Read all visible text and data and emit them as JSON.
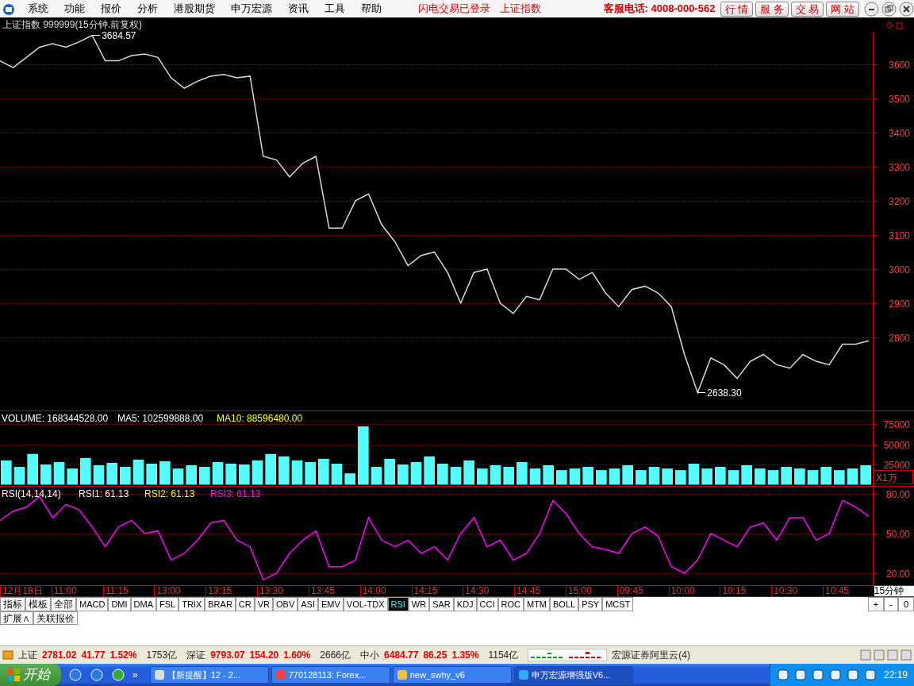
{
  "menu": {
    "items": [
      "系统",
      "功能",
      "报价",
      "分析",
      "港股期货",
      "申万宏源",
      "资讯",
      "工具",
      "帮助"
    ],
    "notices": [
      "闪电交易已登录",
      "上证指数"
    ],
    "hotline": "客服电话: 4008-000-562",
    "buttons": [
      "行 情",
      "服 务",
      "交 易",
      "网 站"
    ]
  },
  "chart_title": "上证指数 999999(15分钟.前复权)",
  "price_panel": {
    "chart_data": {
      "type": "line",
      "ylim": [
        2586,
        3695
      ],
      "yticks": [
        2800,
        2900,
        3000,
        3100,
        3200,
        3300,
        3400,
        3500,
        3600
      ],
      "grid": true,
      "series": [
        {
          "color": "#d8d8d8",
          "values": [
            3610,
            3590,
            3620,
            3650,
            3660,
            3650,
            3665,
            3684.57,
            3610,
            3610,
            3625,
            3630,
            3620,
            3560,
            3530,
            3550,
            3565,
            3570,
            3560,
            3565,
            3330,
            3320,
            3270,
            3310,
            3330,
            3120,
            3120,
            3200,
            3220,
            3130,
            3080,
            3010,
            3040,
            3050,
            2990,
            2900,
            2990,
            3000,
            2900,
            2870,
            2920,
            2910,
            3000,
            3000,
            2970,
            2990,
            2930,
            2890,
            2940,
            2950,
            2930,
            2890,
            2750,
            2638.3,
            2740,
            2720,
            2680,
            2730,
            2750,
            2720,
            2710,
            2750,
            2730,
            2720,
            2780,
            2780,
            2790
          ]
        }
      ],
      "annotations": [
        "3684.57",
        "2638.30"
      ]
    }
  },
  "volume_panel": {
    "legend": [
      {
        "text": "VOLUME: 168344528.00",
        "color": "#ffffff"
      },
      {
        "text": "MA5: 102599888.00",
        "color": "#ffffff"
      },
      {
        "text": "MA10: 88596480.00",
        "color": "#ffff00"
      }
    ],
    "unit": "X1万",
    "chart_data": {
      "type": "bar",
      "ylim": [
        -1500,
        91700
      ],
      "yticks": [
        25000,
        50000,
        75000
      ],
      "grid": true,
      "series": [
        {
          "color": "#54fcfc",
          "values": [
            30000,
            22000,
            38000,
            25000,
            28000,
            20000,
            33000,
            24000,
            27000,
            22000,
            31000,
            26000,
            29000,
            20000,
            24000,
            22000,
            28000,
            26000,
            25000,
            30000,
            38000,
            35000,
            30000,
            28000,
            32000,
            26000,
            14000,
            72000,
            22000,
            32000,
            25000,
            28000,
            35000,
            26000,
            22000,
            30000,
            20000,
            24000,
            22000,
            28000,
            20000,
            24000,
            18000,
            20000,
            22000,
            18000,
            20000,
            24000,
            18000,
            22000,
            20000,
            18000,
            26000,
            20000,
            22000,
            18000,
            24000,
            20000,
            18000,
            22000,
            20000,
            18000,
            22000,
            18000,
            20000,
            24000
          ]
        }
      ]
    }
  },
  "rsi_panel": {
    "legend": [
      {
        "text": "RSI(14,14,14)",
        "color": "#ffffff"
      },
      {
        "text": "RSI1: 61.13",
        "color": "#ffffff"
      },
      {
        "text": "RSI2: 61.13",
        "color": "#ffff00"
      },
      {
        "text": "RSI3: 61.13",
        "color": "#ff00ff"
      }
    ],
    "chart_data": {
      "type": "line",
      "ylim": [
        11,
        86
      ],
      "yticks": [
        {
          "value": 20,
          "label": "20.00"
        },
        {
          "value": 50,
          "label": "50.00"
        },
        {
          "value": 80,
          "label": "80.00"
        }
      ],
      "grid": true,
      "series": [
        {
          "color": "#ff00ff",
          "values": [
            60,
            67,
            70,
            78,
            62,
            72,
            68,
            55,
            40,
            55,
            60,
            50,
            52,
            30,
            35,
            45,
            58,
            60,
            45,
            40,
            15,
            20,
            35,
            45,
            52,
            25,
            25,
            30,
            62,
            45,
            40,
            45,
            35,
            40,
            30,
            50,
            62,
            40,
            45,
            30,
            35,
            50,
            75,
            65,
            50,
            40,
            38,
            35,
            50,
            55,
            48,
            25,
            20,
            30,
            50,
            45,
            40,
            55,
            58,
            45,
            62,
            62,
            45,
            50,
            75,
            70,
            63
          ]
        }
      ]
    }
  },
  "time_axis": {
    "labels": [
      "12月18日",
      "11:00",
      "11:15",
      "13:00",
      "13:15",
      "13:30",
      "13:45",
      "14:00",
      "14:15",
      "14:30",
      "14:45",
      "15:00",
      "09:45",
      "10:00",
      "10:15",
      "10:30",
      "10:45"
    ],
    "period": "15分钟"
  },
  "indicator_tabs": [
    {
      "label": "指标",
      "selected": false,
      "kind": "group"
    },
    {
      "label": "模板",
      "selected": false,
      "kind": "group"
    },
    {
      "label": "全部",
      "selected": false,
      "kind": "group"
    },
    {
      "label": "MACD",
      "selected": false
    },
    {
      "label": "DMI",
      "selected": false
    },
    {
      "label": "DMA",
      "selected": false
    },
    {
      "label": "FSL",
      "selected": false
    },
    {
      "label": "TRIX",
      "selected": false
    },
    {
      "label": "BRAR",
      "selected": false
    },
    {
      "label": "CR",
      "selected": false
    },
    {
      "label": "VR",
      "selected": false
    },
    {
      "label": "OBV",
      "selected": false
    },
    {
      "label": "ASI",
      "selected": false
    },
    {
      "label": "EMV",
      "selected": false
    },
    {
      "label": "VOL-TDX",
      "selected": false
    },
    {
      "label": "RSI",
      "selected": true
    },
    {
      "label": "WR",
      "selected": false
    },
    {
      "label": "SAR",
      "selected": false
    },
    {
      "label": "KDJ",
      "selected": false
    },
    {
      "label": "CCI",
      "selected": false
    },
    {
      "label": "ROC",
      "selected": false
    },
    {
      "label": "MTM",
      "selected": false
    },
    {
      "label": "BOLL",
      "selected": false
    },
    {
      "label": "PSY",
      "selected": false
    },
    {
      "label": "MCST",
      "selected": false
    }
  ],
  "zoom_buttons": [
    "+",
    "-",
    "0"
  ],
  "sub_tabs": [
    "扩展∧",
    "关联报价"
  ],
  "status_bar": {
    "indices": [
      {
        "name": "上证",
        "price": "2781.02",
        "change": "41.77",
        "pct": "1.52%",
        "amount": "1753亿"
      },
      {
        "name": "深证",
        "price": "9793.07",
        "change": "154.20",
        "pct": "1.60%",
        "amount": "2666亿"
      },
      {
        "name": "中小",
        "price": "6484.77",
        "change": "86.25",
        "pct": "1.35%",
        "amount": "1154亿"
      }
    ],
    "server": "宏源证券阿里云(4)"
  },
  "taskbar": {
    "start": "开始",
    "overflow": "»",
    "tasks": [
      {
        "label": "【新提醒】12 - 2...",
        "selected": false
      },
      {
        "label": "770128113: Forex...",
        "selected": false
      },
      {
        "label": "new_swhy_v6",
        "selected": false
      },
      {
        "label": "申万宏源增强版V6...",
        "selected": true
      }
    ],
    "clock": "22:19"
  }
}
